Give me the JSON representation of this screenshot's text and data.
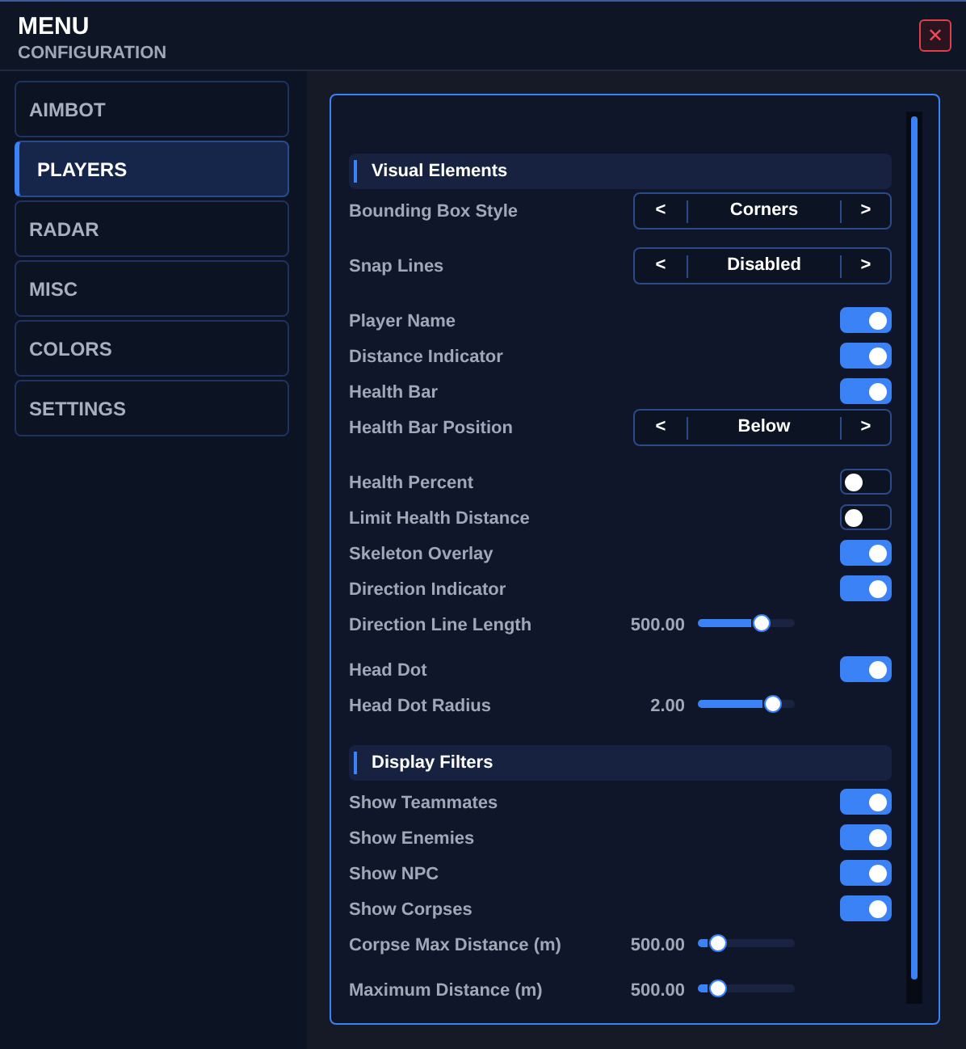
{
  "header": {
    "title": "MENU",
    "subtitle": "CONFIGURATION",
    "close": "✕"
  },
  "sidebar": {
    "items": [
      {
        "label": "AIMBOT",
        "selected": false
      },
      {
        "label": "PLAYERS",
        "selected": true
      },
      {
        "label": "RADAR",
        "selected": false
      },
      {
        "label": "MISC",
        "selected": false
      },
      {
        "label": "COLORS",
        "selected": false
      },
      {
        "label": "SETTINGS",
        "selected": false
      }
    ]
  },
  "settings": [
    {
      "kind": "section",
      "label": "Visual Elements"
    },
    {
      "kind": "selector",
      "label": "Bounding Box Style",
      "prev": "<",
      "value": "Corners",
      "next": ">"
    },
    {
      "kind": "selector",
      "label": "Snap Lines",
      "prev": "<",
      "value": "Disabled",
      "next": ">"
    },
    {
      "kind": "toggle",
      "label": "Player Name",
      "on": true
    },
    {
      "kind": "toggle",
      "label": "Distance Indicator",
      "on": true
    },
    {
      "kind": "toggle",
      "label": "Health Bar",
      "on": true
    },
    {
      "kind": "selector",
      "label": "Health Bar Position",
      "prev": "<",
      "value": "Below",
      "next": ">"
    },
    {
      "kind": "toggle",
      "label": "Health Percent",
      "on": false
    },
    {
      "kind": "toggle",
      "label": "Limit Health Distance",
      "on": false
    },
    {
      "kind": "toggle",
      "label": "Skeleton Overlay",
      "on": true
    },
    {
      "kind": "toggle",
      "label": "Direction Indicator",
      "on": true
    },
    {
      "kind": "slider",
      "label": "Direction Line Length",
      "reading": "500.00",
      "level": 0.65
    },
    {
      "kind": "toggle",
      "label": "Head Dot",
      "on": true
    },
    {
      "kind": "slider",
      "label": "Head Dot Radius",
      "reading": "2.00",
      "level": 0.77
    },
    {
      "kind": "section",
      "label": "Display Filters"
    },
    {
      "kind": "toggle",
      "label": "Show Teammates",
      "on": true
    },
    {
      "kind": "toggle",
      "label": "Show Enemies",
      "on": true
    },
    {
      "kind": "toggle",
      "label": "Show NPC",
      "on": true
    },
    {
      "kind": "toggle",
      "label": "Show Corpses",
      "on": true
    },
    {
      "kind": "slider",
      "label": "Corpse Max Distance (m)",
      "reading": "500.00",
      "level": 0.2
    },
    {
      "kind": "slider",
      "label": "Maximum Distance (m)",
      "reading": "500.00",
      "level": 0.2
    }
  ]
}
